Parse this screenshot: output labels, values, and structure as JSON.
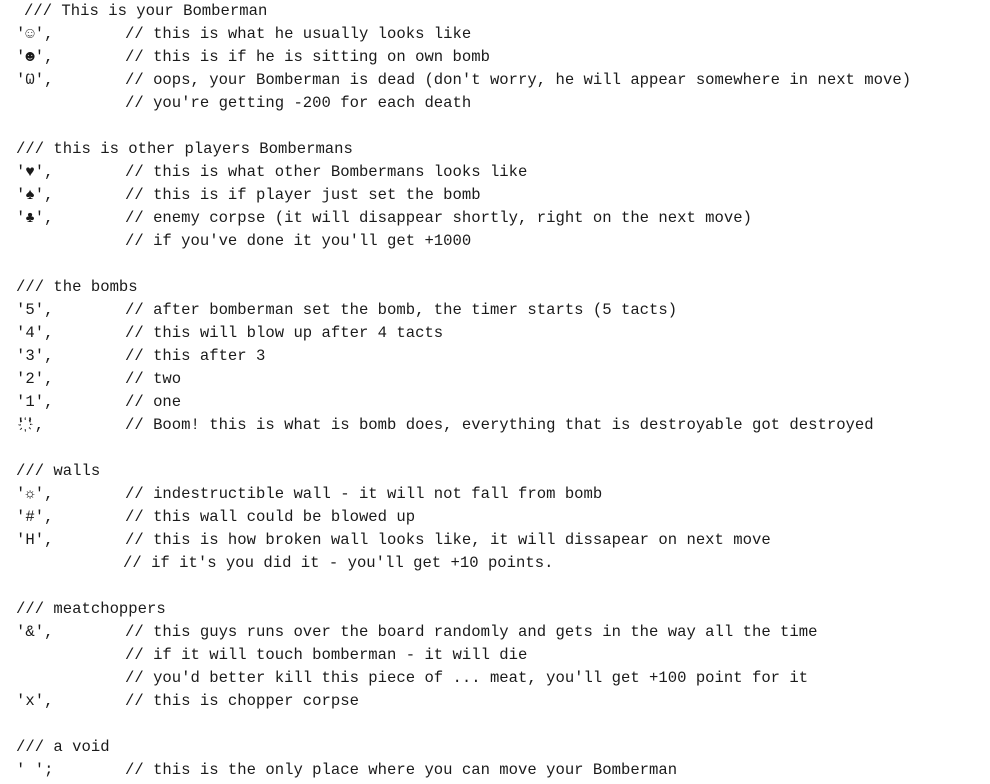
{
  "sections": [
    {
      "heading": "/// This is your Bomberman",
      "lines": [
        {
          "symbol": "'☺',",
          "comment": "// this is what he usually looks like"
        },
        {
          "symbol": "'☻',",
          "comment": "// this is if he is sitting on own bomb"
        },
        {
          "symbol": "'Ѡ',",
          "comment": "// oops, your Bomberman is dead (don't worry, he will appear somewhere in next move)"
        },
        {
          "symbol": "",
          "comment": "// you're getting -200 for each death"
        }
      ]
    },
    {
      "heading": "/// this is other players Bombermans",
      "lines": [
        {
          "symbol": "'♥',",
          "comment": "// this is what other Bombermans looks like"
        },
        {
          "symbol": "'♠',",
          "comment": "// this is if player just set the bomb"
        },
        {
          "symbol": "'♣',",
          "comment": "// enemy corpse (it will disappear shortly, right on the next move)"
        },
        {
          "symbol": "",
          "comment": "// if you've done it you'll get +1000"
        }
      ]
    },
    {
      "heading": "/// the bombs",
      "lines": [
        {
          "symbol": "'5',",
          "comment": "// after bomberman set the bomb, the timer starts (5 tacts)"
        },
        {
          "symbol": "'4',",
          "comment": "// this will blow up after 4 tacts"
        },
        {
          "symbol": "'3',",
          "comment": "// this after 3"
        },
        {
          "symbol": "'2',",
          "comment": "// two"
        },
        {
          "symbol": "'1',",
          "comment": "// one"
        },
        {
          "symbol": "'҉',",
          "comment": "// Boom! this is what is bomb does, everything that is destroyable got destroyed"
        }
      ]
    },
    {
      "heading": "/// walls",
      "lines": [
        {
          "symbol": "'☼',",
          "comment": "// indestructible wall - it will not fall from bomb"
        },
        {
          "symbol": "'#',",
          "comment": "// this wall could be blowed up"
        },
        {
          "symbol": "'H',",
          "comment": "// this is how broken wall looks like, it will dissapear on next move"
        },
        {
          "symbol": "",
          "comment": "// if it's you did it - you'll get +10 points."
        }
      ]
    },
    {
      "heading": "/// meatchoppers",
      "lines": [
        {
          "symbol": "'&',",
          "comment": "// this guys runs over the board randomly and gets in the way all the time"
        },
        {
          "symbol": "",
          "comment": "// if it will touch bomberman - it will die"
        },
        {
          "symbol": "",
          "comment": "// you'd better kill this piece of ... meat, you'll get +100 point for it"
        },
        {
          "symbol": "'x',",
          "comment": "// this is chopper corpse"
        }
      ]
    },
    {
      "heading": "/// a void",
      "lines": [
        {
          "symbol": "' ';",
          "comment": "// this is the only place where you can move your Bomberman"
        }
      ]
    }
  ]
}
